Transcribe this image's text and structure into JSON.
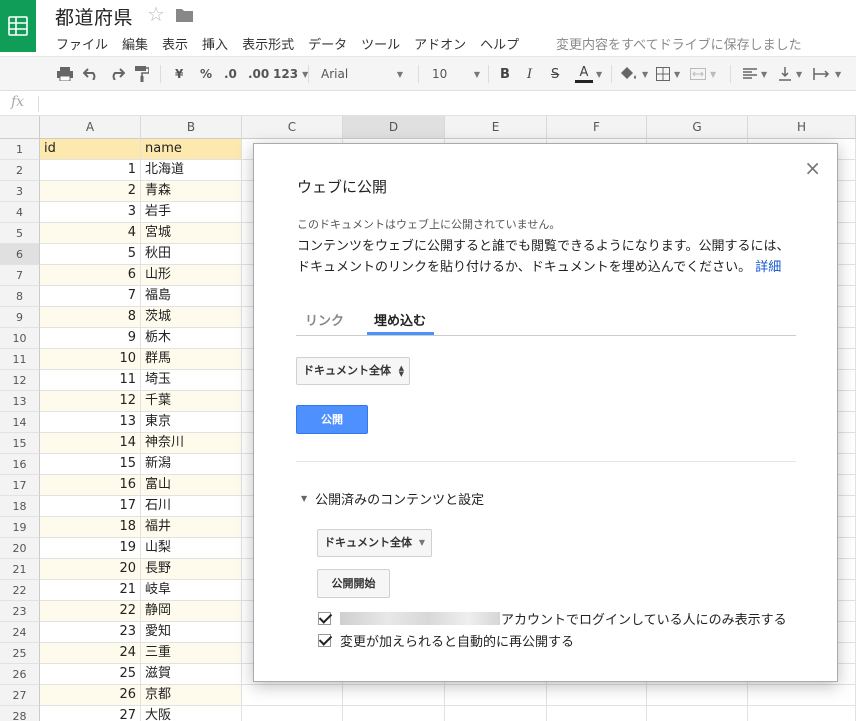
{
  "header": {
    "doc_title": "都道府県",
    "menu": [
      "ファイル",
      "編集",
      "表示",
      "挿入",
      "表示形式",
      "データ",
      "ツール",
      "アドオン",
      "ヘルプ"
    ],
    "save_status": "変更内容をすべてドライブに保存しました"
  },
  "toolbar": {
    "currency": "¥",
    "percent": "%",
    "dec_decrease": ".0",
    "dec_increase": ".00",
    "number_format": "123",
    "font": "Arial",
    "font_size": "10",
    "bold": "B",
    "italic": "I",
    "strike": "S",
    "text_color": "A"
  },
  "formula_bar": {
    "fx": "fx"
  },
  "grid": {
    "columns": [
      "A",
      "B",
      "C",
      "D",
      "E",
      "F",
      "G",
      "H"
    ],
    "selected_column": "D",
    "selected_row": 6,
    "header": {
      "id": "id",
      "name": "name"
    },
    "rows": [
      [
        "1",
        "北海道"
      ],
      [
        "2",
        "青森"
      ],
      [
        "3",
        "岩手"
      ],
      [
        "4",
        "宮城"
      ],
      [
        "5",
        "秋田"
      ],
      [
        "6",
        "山形"
      ],
      [
        "7",
        "福島"
      ],
      [
        "8",
        "茨城"
      ],
      [
        "9",
        "栃木"
      ],
      [
        "10",
        "群馬"
      ],
      [
        "11",
        "埼玉"
      ],
      [
        "12",
        "千葉"
      ],
      [
        "13",
        "東京"
      ],
      [
        "14",
        "神奈川"
      ],
      [
        "15",
        "新潟"
      ],
      [
        "16",
        "富山"
      ],
      [
        "17",
        "石川"
      ],
      [
        "18",
        "福井"
      ],
      [
        "19",
        "山梨"
      ],
      [
        "20",
        "長野"
      ],
      [
        "21",
        "岐阜"
      ],
      [
        "22",
        "静岡"
      ],
      [
        "23",
        "愛知"
      ],
      [
        "24",
        "三重"
      ],
      [
        "25",
        "滋賀"
      ],
      [
        "26",
        "京都"
      ],
      [
        "27",
        "大阪"
      ]
    ]
  },
  "dialog": {
    "title": "ウェブに公開",
    "note": "このドキュメントはウェブ上に公開されていません。",
    "desc": "コンテンツをウェブに公開すると誰でも閲覧できるようになります。公開するには、ドキュメントのリンクを貼り付けるか、ドキュメントを埋め込んでください。",
    "details_link": "詳細",
    "tab_link": "リンク",
    "tab_embed": "埋め込む",
    "scope_select": "ドキュメント全体",
    "publish_button": "公開",
    "section_title": "公開済みのコンテンツと設定",
    "scope_select_2": "ドキュメント全体",
    "start_button": "公開開始",
    "chk_account": "アカウントでログインしている人にのみ表示する",
    "chk_republish": "変更が加えられると自動的に再公開する",
    "close": "×"
  }
}
